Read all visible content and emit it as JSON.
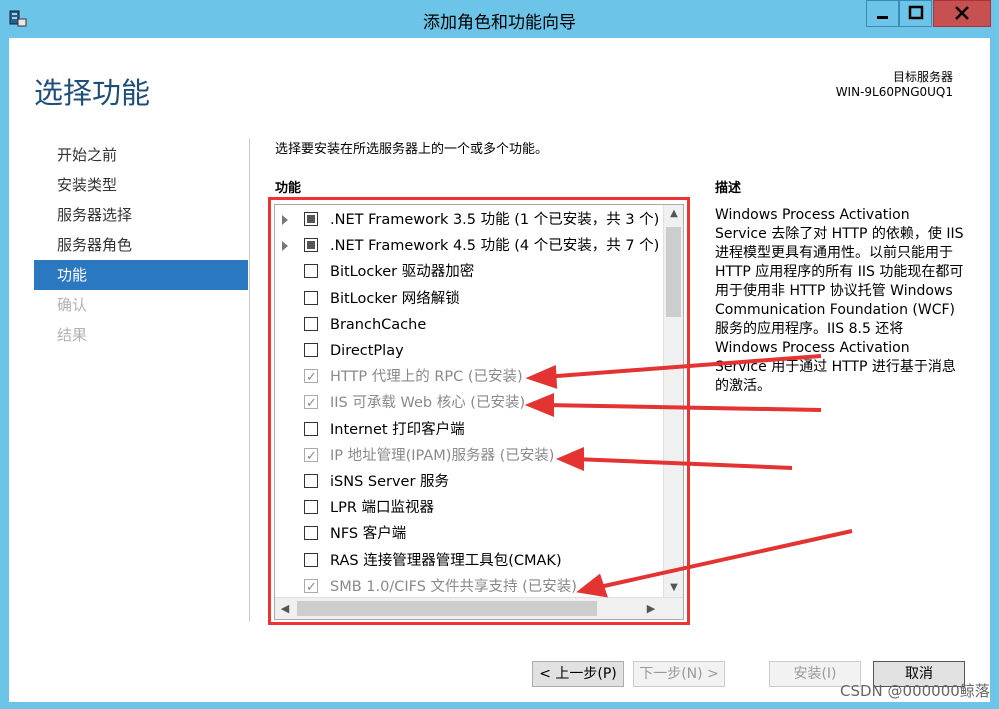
{
  "window": {
    "title": "添加角色和功能向导",
    "minimize_label": "—",
    "maximize_label": "□",
    "close_label": "✕"
  },
  "header": {
    "page_title": "选择功能",
    "destination_label": "目标服务器",
    "destination_server": "WIN-9L60PNG0UQ1"
  },
  "nav": {
    "items": [
      {
        "label": "开始之前",
        "state": "normal"
      },
      {
        "label": "安装类型",
        "state": "normal"
      },
      {
        "label": "服务器选择",
        "state": "normal"
      },
      {
        "label": "服务器角色",
        "state": "normal"
      },
      {
        "label": "功能",
        "state": "active"
      },
      {
        "label": "确认",
        "state": "disabled"
      },
      {
        "label": "结果",
        "state": "disabled"
      }
    ]
  },
  "main": {
    "instruction": "选择要安装在所选服务器上的一个或多个功能。",
    "features_heading": "功能",
    "features": [
      {
        "label": ".NET Framework 3.5 功能 (1 个已安装，共 3 个)",
        "expandable": true,
        "state": "partial"
      },
      {
        "label": ".NET Framework 4.5 功能 (4 个已安装，共 7 个)",
        "expandable": true,
        "state": "partial"
      },
      {
        "label": "BitLocker 驱动器加密",
        "expandable": false,
        "state": "unchecked"
      },
      {
        "label": "BitLocker 网络解锁",
        "expandable": false,
        "state": "unchecked"
      },
      {
        "label": "BranchCache",
        "expandable": false,
        "state": "unchecked"
      },
      {
        "label": "DirectPlay",
        "expandable": false,
        "state": "unchecked"
      },
      {
        "label": "HTTP 代理上的 RPC (已安装)",
        "expandable": false,
        "state": "installed"
      },
      {
        "label": "IIS 可承载 Web 核心 (已安装)",
        "expandable": false,
        "state": "installed"
      },
      {
        "label": "Internet 打印客户端",
        "expandable": false,
        "state": "unchecked"
      },
      {
        "label": "IP 地址管理(IPAM)服务器 (已安装)",
        "expandable": false,
        "state": "installed"
      },
      {
        "label": "iSNS Server 服务",
        "expandable": false,
        "state": "unchecked"
      },
      {
        "label": "LPR 端口监视器",
        "expandable": false,
        "state": "unchecked"
      },
      {
        "label": "NFS 客户端",
        "expandable": false,
        "state": "unchecked"
      },
      {
        "label": "RAS 连接管理器管理工具包(CMAK)",
        "expandable": false,
        "state": "unchecked"
      },
      {
        "label": "SMB 1.0/CIFS 文件共享支持 (已安装)",
        "expandable": false,
        "state": "installed"
      }
    ],
    "description_heading": "描述",
    "description_text": "Windows Process Activation Service 去除了对 HTTP 的依赖，使 IIS 进程模型更具有通用性。以前只能用于 HTTP 应用程序的所有 IIS 功能现在都可用于使用非 HTTP 协议托管 Windows Communication Foundation (WCF)服务的应用程序。IIS 8.5 还将 Windows Process Activation Service 用于通过 HTTP 进行基于消息的激活。"
  },
  "buttons": {
    "previous": "< 上一步(P)",
    "next": "下一步(N) >",
    "install": "安装(I)",
    "cancel": "取消"
  },
  "watermark": "CSDN @000000鲸落",
  "colors": {
    "title_bar": "#6cc4e8",
    "nav_active": "#2a78c0",
    "annotation_red": "#e33333",
    "page_title": "#1f4e79"
  }
}
